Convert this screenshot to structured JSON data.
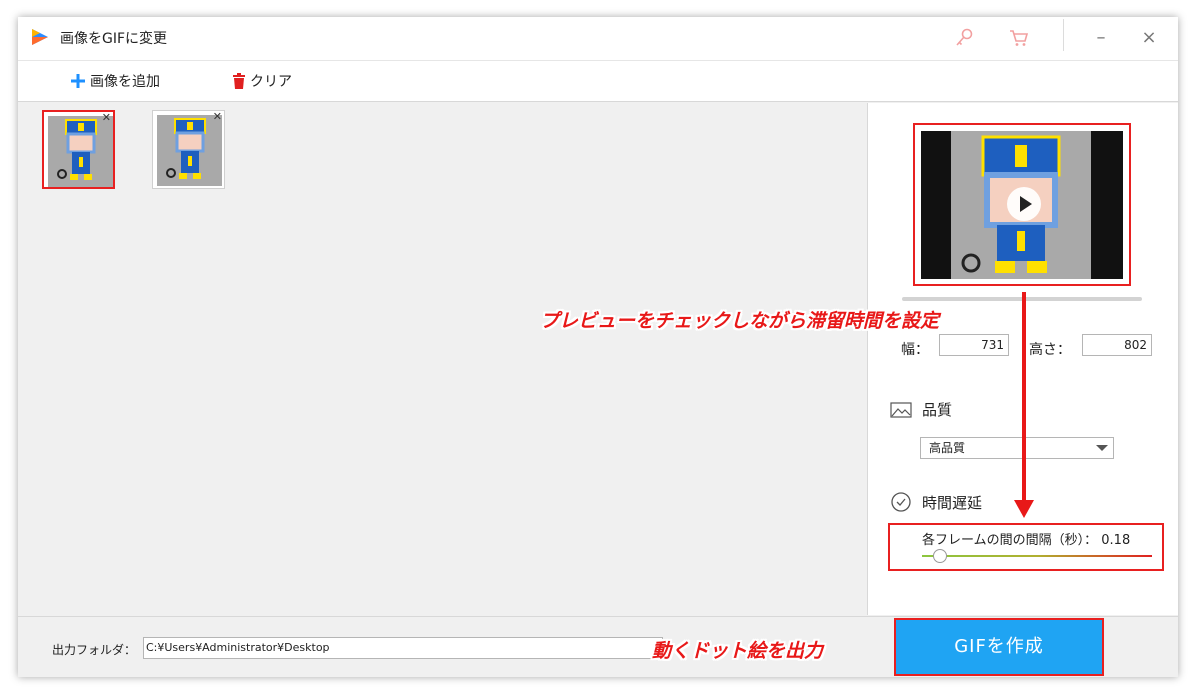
{
  "window": {
    "title": "画像をGIFに変更"
  },
  "toolbar": {
    "add_label": "画像を追加",
    "clear_label": "クリア"
  },
  "preview": {
    "width_label": "幅：",
    "width_value": "731",
    "height_label": "高さ：",
    "height_value": "802"
  },
  "quality": {
    "heading": "品質",
    "selected": "高品質"
  },
  "delay": {
    "heading": "時間遅延",
    "interval_label": "各フレームの間の間隔（秒）：",
    "interval_value": "0.18",
    "slider_fraction": 0.08
  },
  "output": {
    "folder_label": "出力フォルダ：",
    "folder_path": "C:¥Users¥Administrator¥Desktop",
    "create_label": "GIFを作成"
  },
  "annotations": {
    "preview_note": "プレビューをチェックしながら滞留時間を設定",
    "output_note": "動くドット絵を出力"
  },
  "colors": {
    "accent": "#1fa4f3",
    "annotation": "#e81818",
    "add_icon": "#1e90ff",
    "clear_icon": "#e02020"
  },
  "icons": {
    "add": "plus-icon",
    "clear": "trash-icon",
    "key": "key-icon",
    "cart": "cart-icon",
    "quality": "image-icon",
    "delay": "clock-icon",
    "play": "play-icon"
  }
}
